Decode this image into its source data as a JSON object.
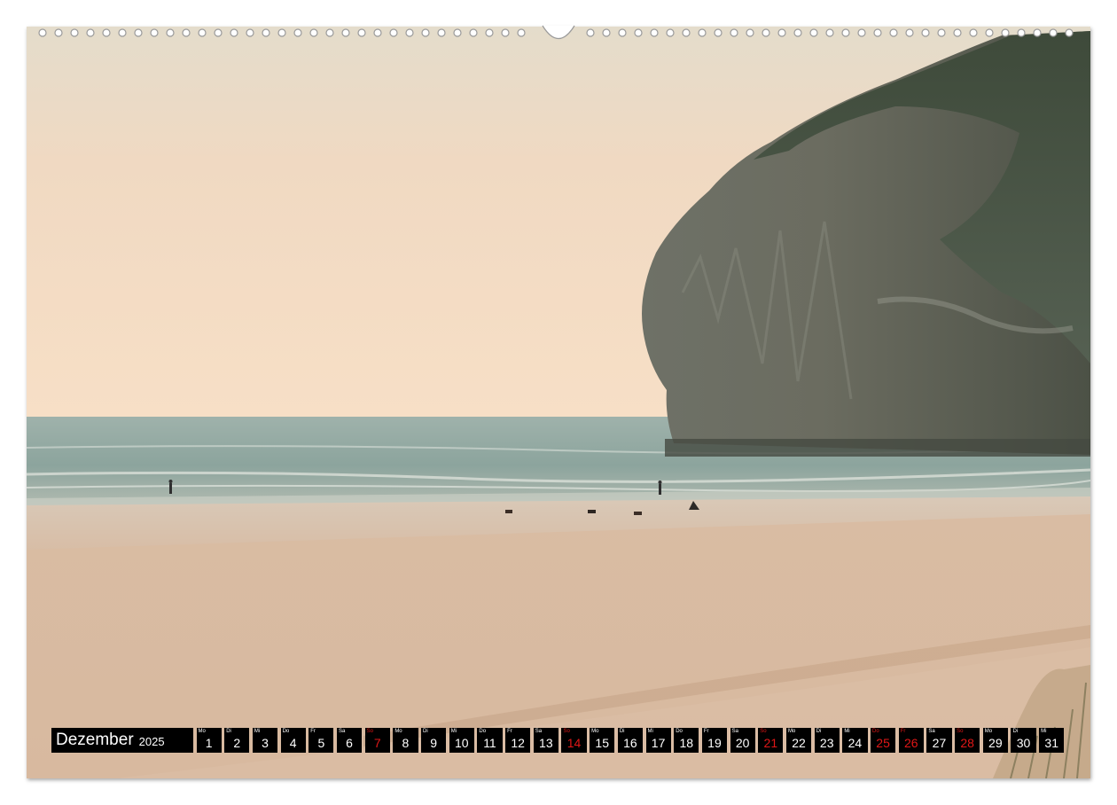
{
  "calendar": {
    "month": "Dezember",
    "year": "2025",
    "days": [
      {
        "abbr": "Mo",
        "num": "1",
        "red": false
      },
      {
        "abbr": "Di",
        "num": "2",
        "red": false
      },
      {
        "abbr": "Mi",
        "num": "3",
        "red": false
      },
      {
        "abbr": "Do",
        "num": "4",
        "red": false
      },
      {
        "abbr": "Fr",
        "num": "5",
        "red": false
      },
      {
        "abbr": "Sa",
        "num": "6",
        "red": false
      },
      {
        "abbr": "So",
        "num": "7",
        "red": true
      },
      {
        "abbr": "Mo",
        "num": "8",
        "red": false
      },
      {
        "abbr": "Di",
        "num": "9",
        "red": false
      },
      {
        "abbr": "Mi",
        "num": "10",
        "red": false
      },
      {
        "abbr": "Do",
        "num": "11",
        "red": false
      },
      {
        "abbr": "Fr",
        "num": "12",
        "red": false
      },
      {
        "abbr": "Sa",
        "num": "13",
        "red": false
      },
      {
        "abbr": "So",
        "num": "14",
        "red": true
      },
      {
        "abbr": "Mo",
        "num": "15",
        "red": false
      },
      {
        "abbr": "Di",
        "num": "16",
        "red": false
      },
      {
        "abbr": "Mi",
        "num": "17",
        "red": false
      },
      {
        "abbr": "Do",
        "num": "18",
        "red": false
      },
      {
        "abbr": "Fr",
        "num": "19",
        "red": false
      },
      {
        "abbr": "Sa",
        "num": "20",
        "red": false
      },
      {
        "abbr": "So",
        "num": "21",
        "red": true
      },
      {
        "abbr": "Mo",
        "num": "22",
        "red": false
      },
      {
        "abbr": "Di",
        "num": "23",
        "red": false
      },
      {
        "abbr": "Mi",
        "num": "24",
        "red": false
      },
      {
        "abbr": "Do",
        "num": "25",
        "red": true
      },
      {
        "abbr": "Fr",
        "num": "26",
        "red": true
      },
      {
        "abbr": "Sa",
        "num": "27",
        "red": false
      },
      {
        "abbr": "So",
        "num": "28",
        "red": true
      },
      {
        "abbr": "Mo",
        "num": "29",
        "red": false
      },
      {
        "abbr": "Di",
        "num": "30",
        "red": false
      },
      {
        "abbr": "Mi",
        "num": "31",
        "red": false
      }
    ]
  },
  "colors": {
    "calendar_bg": "#000000",
    "calendar_text": "#ffffff",
    "holiday_red": "#e01717",
    "sky_top": "#e7ddcb",
    "sky_bottom": "#f6dcc0",
    "sea": "#8fa7a0",
    "sand": "#d7b89e",
    "cliff": "#5f6357"
  },
  "icons": {
    "binding": "wire-binding-holes-icon",
    "hanger": "hanger-hook-icon"
  }
}
